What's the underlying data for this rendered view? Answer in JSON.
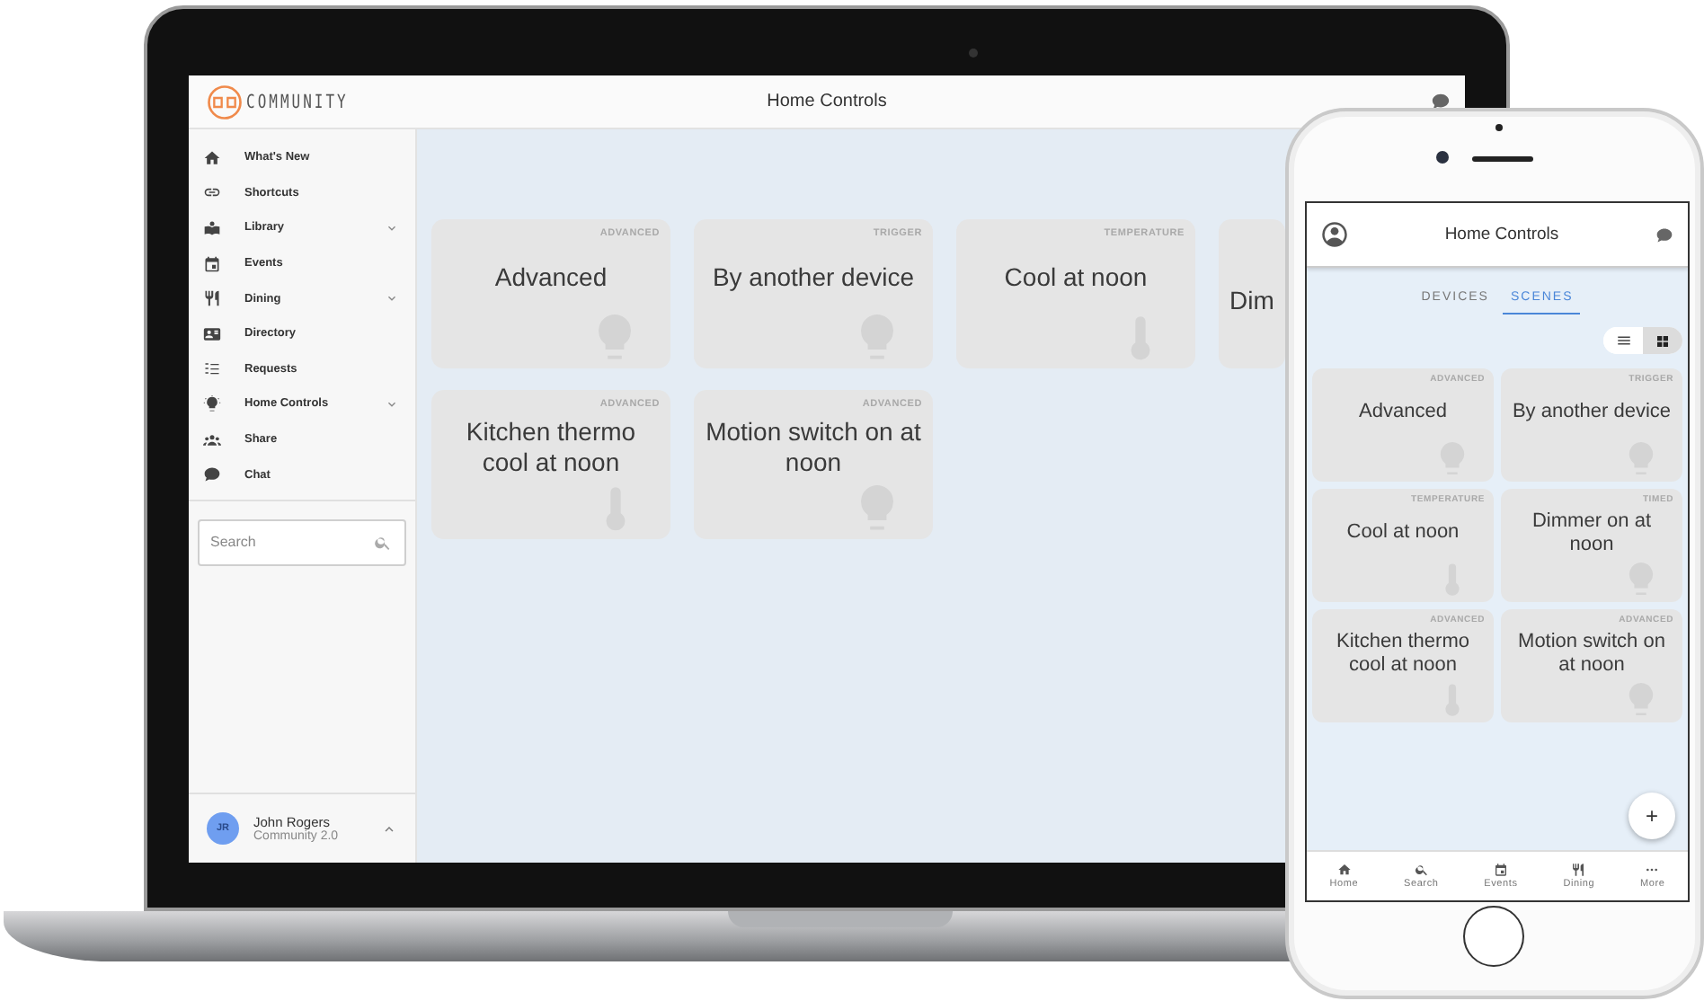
{
  "laptop": {
    "logo_text": "COMMUNITY",
    "header_title": "Home Controls",
    "sidebar": {
      "items": [
        {
          "label": "What's New",
          "expandable": false
        },
        {
          "label": "Shortcuts",
          "expandable": false
        },
        {
          "label": "Library",
          "expandable": true
        },
        {
          "label": "Events",
          "expandable": false
        },
        {
          "label": "Dining",
          "expandable": true
        },
        {
          "label": "Directory",
          "expandable": false
        },
        {
          "label": "Requests",
          "expandable": false
        },
        {
          "label": "Home Controls",
          "expandable": true
        },
        {
          "label": "Share",
          "expandable": false
        },
        {
          "label": "Chat",
          "expandable": false
        }
      ]
    },
    "search": {
      "placeholder": "Search"
    },
    "user": {
      "initials": "JR",
      "name": "John Rogers",
      "subtitle": "Community 2.0"
    },
    "scenes": [
      {
        "tag": "ADVANCED",
        "title": "Advanced",
        "kind": "bulb"
      },
      {
        "tag": "TRIGGER",
        "title": "By another device",
        "kind": "bulb"
      },
      {
        "tag": "TEMPERATURE",
        "title": "Cool at noon",
        "kind": "thermometer"
      },
      {
        "title": "Dim"
      },
      {
        "tag": "ADVANCED",
        "title": "Kitchen thermo cool at noon",
        "kind": "thermometer"
      },
      {
        "tag": "ADVANCED",
        "title": "Motion switch on at noon",
        "kind": "bulb"
      }
    ]
  },
  "phone": {
    "header_title": "Home Controls",
    "tabs": [
      {
        "label": "DEVICES",
        "selected": false
      },
      {
        "label": "SCENES",
        "selected": true
      }
    ],
    "view_toggle": [
      {
        "kind": "list",
        "selected": false
      },
      {
        "kind": "grid",
        "selected": true
      }
    ],
    "scenes": [
      {
        "tag": "ADVANCED",
        "title": "Advanced",
        "kind": "bulb"
      },
      {
        "tag": "TRIGGER",
        "title": "By another device",
        "kind": "bulb"
      },
      {
        "tag": "TEMPERATURE",
        "title": "Cool at noon",
        "kind": "thermometer"
      },
      {
        "tag": "TIMED",
        "title": "Dimmer on at noon",
        "kind": "bulb"
      },
      {
        "tag": "ADVANCED",
        "title": "Kitchen thermo cool at noon",
        "kind": "thermometer"
      },
      {
        "tag": "ADVANCED",
        "title": "Motion switch on at noon",
        "kind": "bulb"
      }
    ],
    "fab": "+",
    "bottom_nav": [
      {
        "label": "Home"
      },
      {
        "label": "Search"
      },
      {
        "label": "Events"
      },
      {
        "label": "Dining"
      },
      {
        "label": "More"
      }
    ]
  }
}
